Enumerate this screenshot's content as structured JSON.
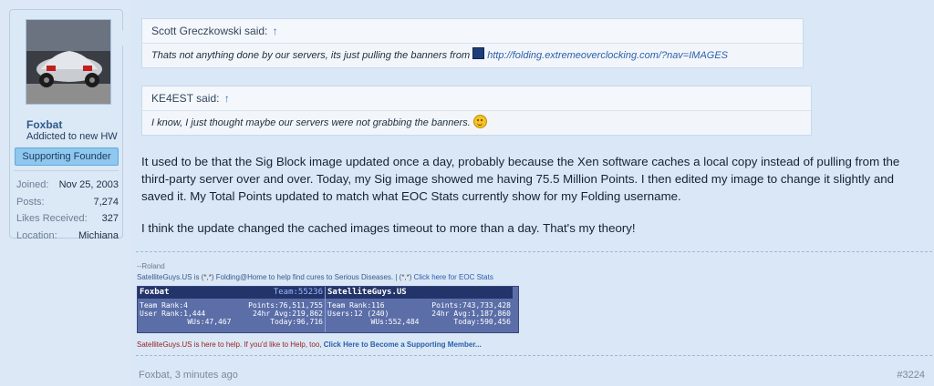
{
  "user": {
    "username": "Foxbat",
    "title": "Addicted to new HW",
    "banner": "Supporting Founder",
    "stats": [
      {
        "key": "Joined:",
        "value": "Nov 25, 2003"
      },
      {
        "key": "Posts:",
        "value": "7,274"
      },
      {
        "key": "Likes Received:",
        "value": "327"
      },
      {
        "key": "Location:",
        "value": "Michiana"
      }
    ]
  },
  "quotes": [
    {
      "author": "Scott Greczkowski said:",
      "arrow": "↑",
      "text": "Thats not anything done by our servers, its just pulling the banners from ",
      "link": "http://folding.extremeoverclocking.com/?nav=IMAGES"
    },
    {
      "author": "KE4EST said:",
      "arrow": "↑",
      "text": "I know, I just thought maybe our servers were not grabbing the banners."
    }
  ],
  "body": {
    "p1": "It used to be that the Sig Block image updated once a day, probably because the Xen software caches a local copy instead of pulling from the third-party server over and over. Today, my Sig image showed me having 75.5 Million Points. I then edited my image to change it slightly and saved it. My Total Points updated to match what EOC Stats currently show for my Folding username.",
    "p2": "I think the update changed the cached images timeout to more than a day. That's my theory!"
  },
  "signature": {
    "credit": "--Roland",
    "line1_prefix": "SatelliteGuys.US is ",
    "line1_mid": " Folding@Home to help find cures to Serious Diseases.  |  ",
    "line1_link": " Click here for EOC Stats",
    "clover": "(*,*)",
    "footer_text": "SatelliteGuys.US is here to help. If you'd like to Help, too, ",
    "footer_link": "Click Here to Become a Supporting Member...",
    "eoc_left": {
      "name": "Foxbat",
      "team": "Team:55236",
      "r1l": "Team Rank:4",
      "r1r": "Points:76,511,755",
      "r2l": "User Rank:1,444",
      "r2r": "24hr Avg:219,862",
      "r3l": "WUs:47,467",
      "r3r": "Today:96,716"
    },
    "eoc_right": {
      "name": "SatelliteGuys.US",
      "r1l": "Team Rank:116",
      "r1r": "Points:743,733,428",
      "r2l": "Users:12 (240)",
      "r2r": "24hr Avg:1,187,860",
      "r3l": "WUs:552,484",
      "r3r": "Today:590,456"
    }
  },
  "meta": {
    "author_time": "Foxbat, 3 minutes ago",
    "post_number": "#3224"
  }
}
